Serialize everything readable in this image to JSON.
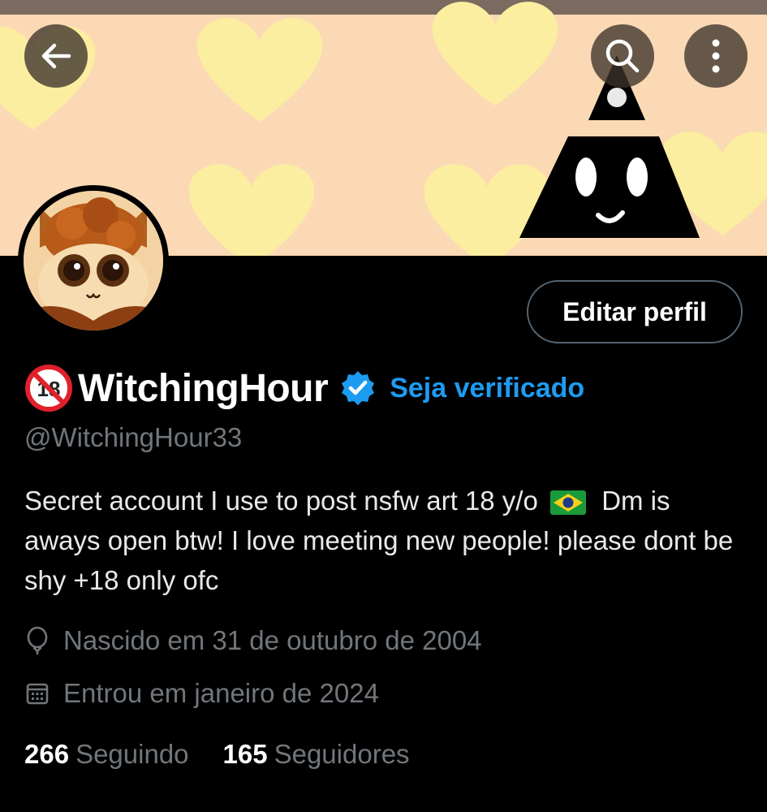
{
  "header": {
    "back_icon": "arrow-left-icon",
    "search_icon": "search-icon",
    "more_icon": "more-vertical-icon"
  },
  "profile": {
    "age_badge_icon": "no-under-18-icon",
    "display_name": "WitchingHour",
    "verified_icon": "verified-badge-icon",
    "get_verified_label": "Seja verificado",
    "handle": "@WitchingHour33",
    "edit_profile_label": "Editar perfil",
    "bio_part1": "Secret account I use to post nsfw art 18 y/o",
    "bio_flag": "brazil-flag-icon",
    "bio_part2": " Dm is aways open btw! I love meeting new people! please dont be shy  +18 only ofc",
    "birthday_icon": "balloon-icon",
    "birthday": "Nascido em 31 de outubro de 2004",
    "joined_icon": "calendar-icon",
    "joined": "Entrou em janeiro de 2024",
    "following_count": "266",
    "following_label": "Seguindo",
    "followers_count": "165",
    "followers_label": "Seguidores"
  },
  "colors": {
    "accent": "#1d9bf0",
    "background": "#000000",
    "secondary_text": "#71767b",
    "banner_bg": "#fbd9b5",
    "banner_hearts": "#fbeea0"
  }
}
